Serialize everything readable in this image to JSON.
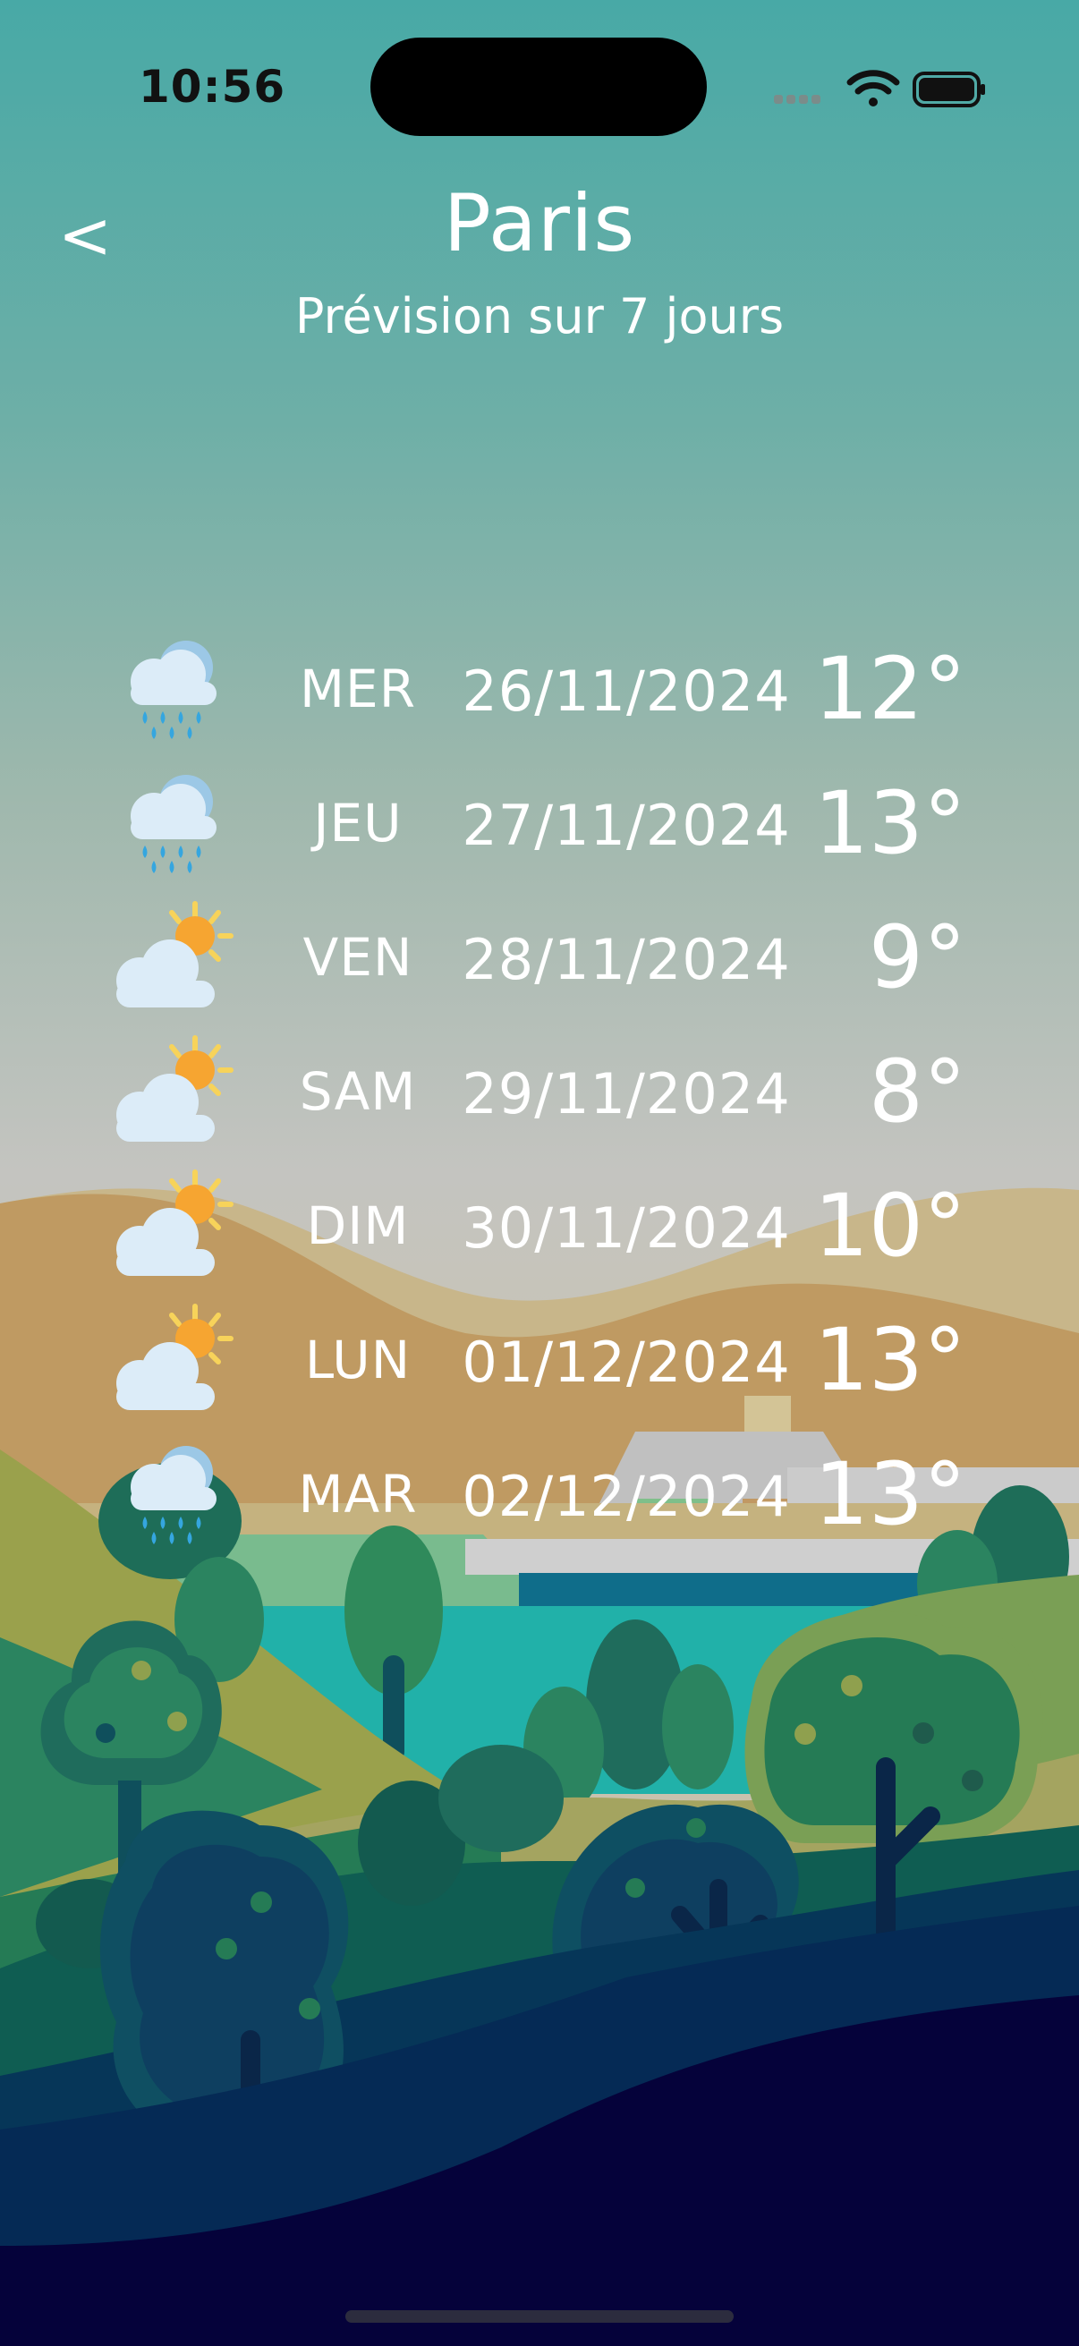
{
  "status_bar": {
    "time": "10:56"
  },
  "header": {
    "back_label": "<",
    "city": "Paris",
    "subtitle": "Prévision sur 7 jours"
  },
  "forecast": [
    {
      "day": "MER",
      "date": "26/11/2024",
      "temp": "12°",
      "icon": "rain-cloud-icon"
    },
    {
      "day": "JEU",
      "date": "27/11/2024",
      "temp": "13°",
      "icon": "rain-cloud-icon"
    },
    {
      "day": "VEN",
      "date": "28/11/2024",
      "temp": "9°",
      "icon": "partly-sunny-icon"
    },
    {
      "day": "SAM",
      "date": "29/11/2024",
      "temp": "8°",
      "icon": "partly-sunny-icon"
    },
    {
      "day": "DIM",
      "date": "30/11/2024",
      "temp": "10°",
      "icon": "partly-sunny-icon"
    },
    {
      "day": "LUN",
      "date": "01/12/2024",
      "temp": "13°",
      "icon": "partly-sunny-icon"
    },
    {
      "day": "MAR",
      "date": "02/12/2024",
      "temp": "13°",
      "icon": "rain-cloud-icon"
    }
  ],
  "colors": {
    "text": "#ffffff",
    "sky_top": "#48a9a6",
    "ground_dark": "#05023a",
    "sun": "#f6a531",
    "rain": "#35a6df",
    "cloud": "#dcecf8"
  }
}
